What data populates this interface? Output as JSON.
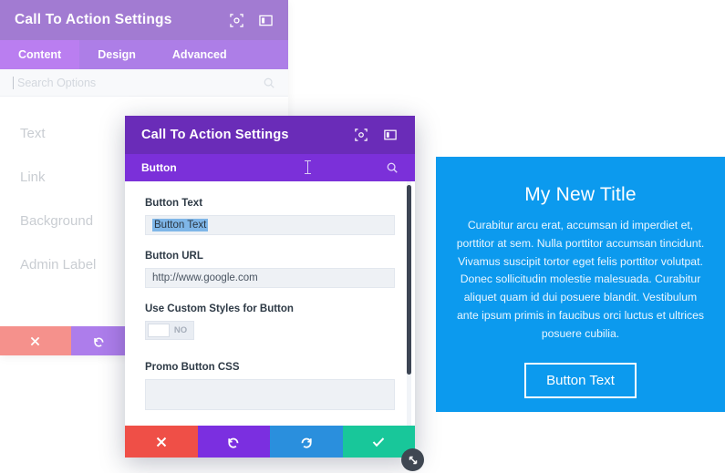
{
  "back_panel": {
    "title": "Call To Action Settings",
    "header_icons": [
      {
        "name": "focus-target-icon"
      },
      {
        "name": "split-layout-icon"
      }
    ],
    "tabs": [
      {
        "label": "Content",
        "active": true
      },
      {
        "label": "Design",
        "active": false
      },
      {
        "label": "Advanced",
        "active": false
      }
    ],
    "search": {
      "placeholder": "Search Options",
      "value": "",
      "icon": "search-icon"
    },
    "items": [
      {
        "label": "Text"
      },
      {
        "label": "Link"
      },
      {
        "label": "Background"
      },
      {
        "label": "Admin Label"
      }
    ],
    "footer": [
      {
        "name": "close-button",
        "icon": "✖",
        "color": "#ef4f47"
      },
      {
        "name": "undo-button",
        "icon": "↺",
        "color": "#7B2FE0"
      }
    ]
  },
  "front_modal": {
    "title": "Call To Action Settings",
    "header_icons": [
      {
        "name": "focus-target-icon"
      },
      {
        "name": "split-layout-icon"
      }
    ],
    "subbar": {
      "label": "Button",
      "search_icon": "search-icon"
    },
    "fields": {
      "button_text": {
        "label": "Button Text",
        "value": "Button Text",
        "selected": true
      },
      "button_url": {
        "label": "Button URL",
        "value": "http://www.google.com",
        "placeholder": "http://www.google.com"
      },
      "custom_styles": {
        "label": "Use Custom Styles for Button",
        "toggle_value": "NO",
        "enabled": false
      },
      "promo_css": {
        "label": "Promo Button CSS",
        "value": ""
      }
    },
    "footer": [
      {
        "name": "close-button",
        "icon": "✖",
        "color": "#ef4f47"
      },
      {
        "name": "undo-button",
        "icon": "↺",
        "color": "#7B2FE0"
      },
      {
        "name": "redo-button",
        "icon": "↻",
        "color": "#2a8fdd"
      },
      {
        "name": "save-button",
        "icon": "✔",
        "color": "#18c79a"
      }
    ],
    "resize_handle": {
      "name": "resize-handle-icon"
    },
    "scrollbar": {
      "name": "vertical-scrollbar"
    }
  },
  "preview": {
    "title": "My New Title",
    "body": "Curabitur arcu erat, accumsan id imperdiet et, porttitor at sem. Nulla porttitor accumsan tincidunt. Vivamus suscipit tortor eget felis porttitor volutpat. Donec sollicitudin molestie malesuada. Curabitur aliquet quam id dui posuere blandit. Vestibulum ante ipsum primis in faucibus orci luctus et ultrices posuere cubilia.",
    "button_label": "Button Text",
    "background_color": "#0C9AEE"
  },
  "colors": {
    "header_purple": "#6A2CB8",
    "bar_purple": "#7B30D9",
    "active_tab_purple": "#9030E8",
    "red": "#ef4f47",
    "purple": "#7B2FE0",
    "blue": "#2a8fdd",
    "green": "#18c79a",
    "preview_blue": "#0C9AEE"
  }
}
